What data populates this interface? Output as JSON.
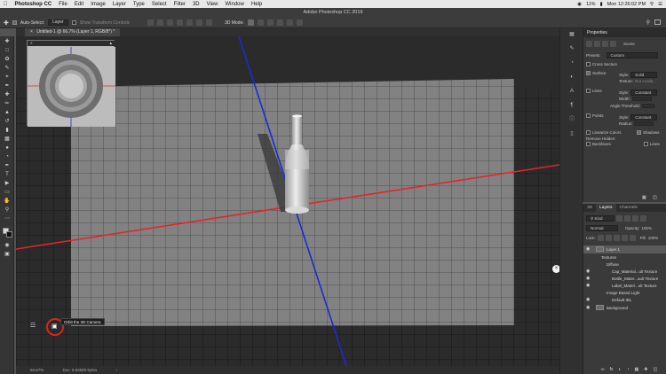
{
  "menubar": {
    "items": [
      "Photoshop CC",
      "File",
      "Edit",
      "Image",
      "Layer",
      "Type",
      "Select",
      "Filter",
      "3D",
      "View",
      "Window",
      "Help"
    ],
    "battery": "11%",
    "clock": "Mon 12:26:02 PM"
  },
  "optionsbar": {
    "window_title": "Adobe Photoshop CC 2019",
    "auto_select_label": "Auto-Select:",
    "auto_select_value": "Layer",
    "transform_label": "Show Transform Controls",
    "mode_label": "3D Mode:"
  },
  "document": {
    "tab_title": "Untitled-1 @ 66.7% (Layer 1, RGB/8*) *"
  },
  "status": {
    "zoom": "66.67%",
    "doc": "Doc: 5.93M/0 bytes"
  },
  "canvas": {
    "camera_tooltip": "Orbit the 3D Camera"
  },
  "properties": {
    "tab": "Properties",
    "section": "Scene",
    "presets_label": "Presets:",
    "presets_value": "Custom",
    "cross_section": "Cross Section",
    "surface": "Surface",
    "style_label": "Style:",
    "surface_style": "Solid",
    "texture_label": "Texture:",
    "texture_value": "Not Availa...",
    "lines": "Lines",
    "lines_style": "Constant",
    "width_label": "Width:",
    "angle_label": "Angle Threshold:",
    "points": "Points",
    "points_style": "Constant",
    "radius_label": "Radius:",
    "linearize": "Linearize Colors",
    "shadows": "Shadows",
    "remove_hidden": "Remove Hidden:",
    "backfaces": "Backfaces",
    "lines_chk": "Lines"
  },
  "layers_panel": {
    "tabs": [
      "3D",
      "Layers",
      "Channels"
    ],
    "active_tab": "Layers",
    "kind": "Kind",
    "blend": "Normal",
    "opacity_label": "Opacity:",
    "opacity": "100%",
    "lock_label": "Lock:",
    "fill_label": "Fill:",
    "fill": "100%",
    "rows": [
      {
        "name": "Layer 1",
        "indent": 0,
        "eye": true,
        "thumb": true
      },
      {
        "name": "Textures",
        "indent": 1,
        "eye": false,
        "thumb": false
      },
      {
        "name": "Diffuse",
        "indent": 2,
        "eye": false,
        "thumb": false
      },
      {
        "name": "Cap_Material...ult Texture",
        "indent": 3,
        "eye": true,
        "thumb": false
      },
      {
        "name": "Bottle_Mater...ault Texture",
        "indent": 3,
        "eye": true,
        "thumb": false
      },
      {
        "name": "Label_Materi...ult Texture",
        "indent": 3,
        "eye": true,
        "thumb": false
      },
      {
        "name": "Image Based Light",
        "indent": 2,
        "eye": false,
        "thumb": false
      },
      {
        "name": "Default IBL",
        "indent": 3,
        "eye": true,
        "thumb": false
      },
      {
        "name": "Background",
        "indent": 0,
        "eye": true,
        "thumb": true
      }
    ]
  },
  "colors": {
    "accent_red_axis": "#e0262a",
    "accent_blue_axis": "#1b2ad6",
    "camera_ring": "#d9231e"
  }
}
